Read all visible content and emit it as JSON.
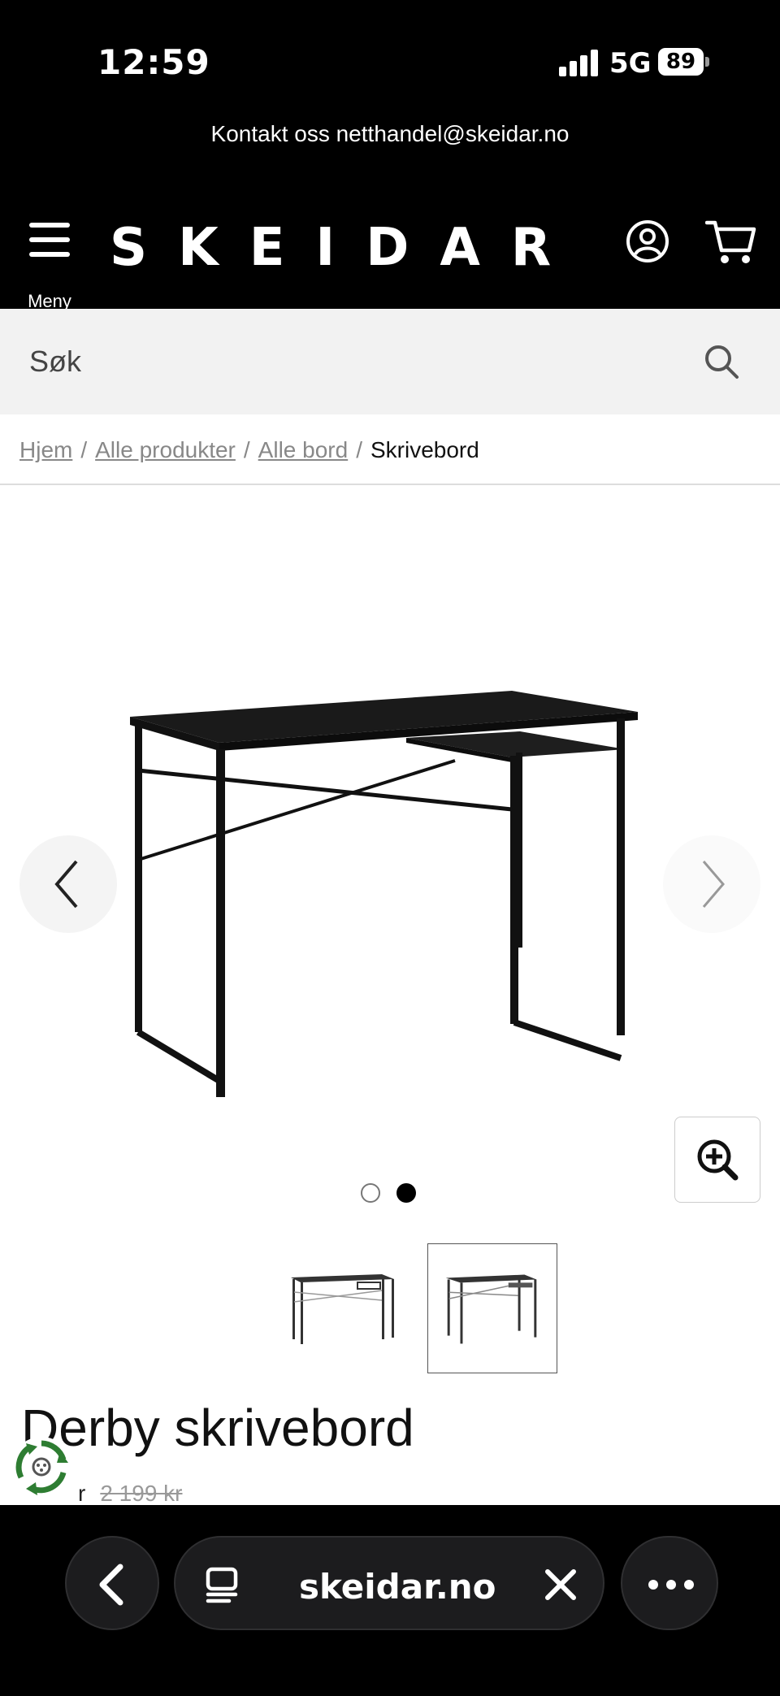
{
  "status_bar": {
    "time": "12:59",
    "network": "5G",
    "battery": "89"
  },
  "announcement": {
    "text": "Kontakt oss netthandel@skeidar.no"
  },
  "header": {
    "menu_label": "Meny",
    "logo": "SKEIDAR"
  },
  "search": {
    "placeholder": "Søk"
  },
  "breadcrumb": {
    "items": [
      "Hjem",
      "Alle produkter",
      "Alle bord"
    ],
    "current": "Skrivebord",
    "separator": "/"
  },
  "gallery": {
    "slide_count": 2,
    "active_slide": 2
  },
  "product": {
    "title": "Derby skrivebord",
    "price_partial": "r",
    "price_old": "2 199 kr"
  },
  "browser": {
    "url": "skeidar.no"
  },
  "colors": {
    "header_bg": "#000000",
    "search_bg": "#f2f2f2",
    "recycle_green": "#2e7d32"
  }
}
